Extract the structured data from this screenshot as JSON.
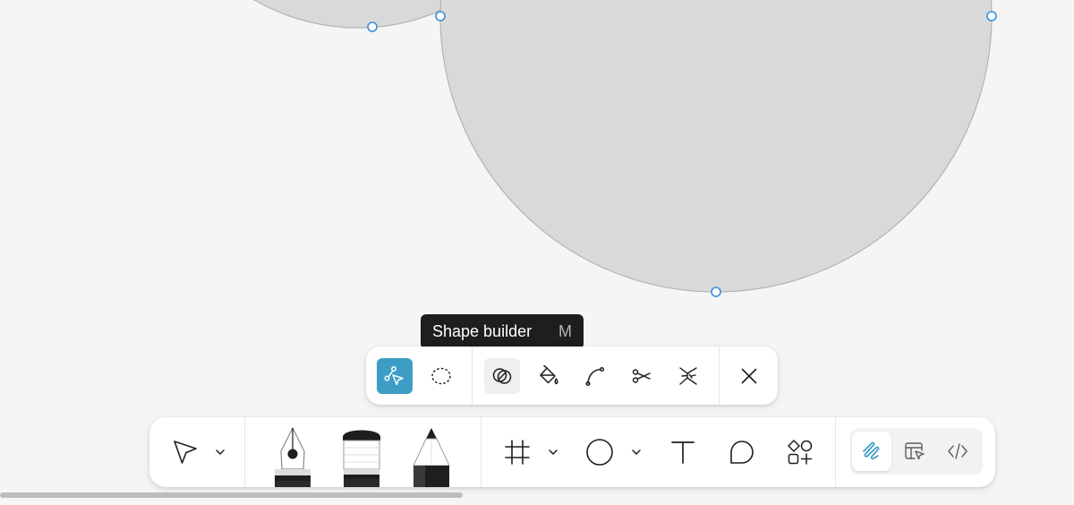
{
  "tooltip": {
    "label": "Shape builder",
    "shortcut": "M"
  },
  "subtoolbar": {
    "tools": [
      {
        "icon": "vector-edit-icon",
        "active": true
      },
      {
        "icon": "lasso-icon",
        "active": false
      },
      {
        "icon": "shape-builder-icon",
        "active": false,
        "hovered": true
      },
      {
        "icon": "paint-bucket-icon",
        "active": false
      },
      {
        "icon": "bend-tool-icon",
        "active": false
      },
      {
        "icon": "cut-icon",
        "active": false
      },
      {
        "icon": "vector-network-icon",
        "active": false
      }
    ],
    "close_icon": "close-icon"
  },
  "toolbar": {
    "tools": [
      {
        "icon": "move-arrow-icon",
        "has_dropdown": true
      },
      {
        "icon": "pen-nib-icon"
      },
      {
        "icon": "brush-icon"
      },
      {
        "icon": "pencil-icon"
      },
      {
        "icon": "frame-icon",
        "has_dropdown": true
      },
      {
        "icon": "ellipse-icon",
        "has_dropdown": true
      },
      {
        "icon": "text-icon"
      },
      {
        "icon": "comment-icon"
      },
      {
        "icon": "components-icon"
      }
    ],
    "modes": [
      {
        "icon": "draw-mode-icon",
        "active": true
      },
      {
        "icon": "design-mode-icon",
        "active": false
      },
      {
        "icon": "dev-mode-icon",
        "active": false
      }
    ]
  },
  "colors": {
    "accent": "#3d9dc4",
    "selection_handle": "#3a8fd9",
    "shape_fill": "#d9d9d9",
    "shape_stroke": "#b3b3b3",
    "canvas_bg": "#f5f5f5",
    "tooltip_bg": "#1e1e1e"
  }
}
